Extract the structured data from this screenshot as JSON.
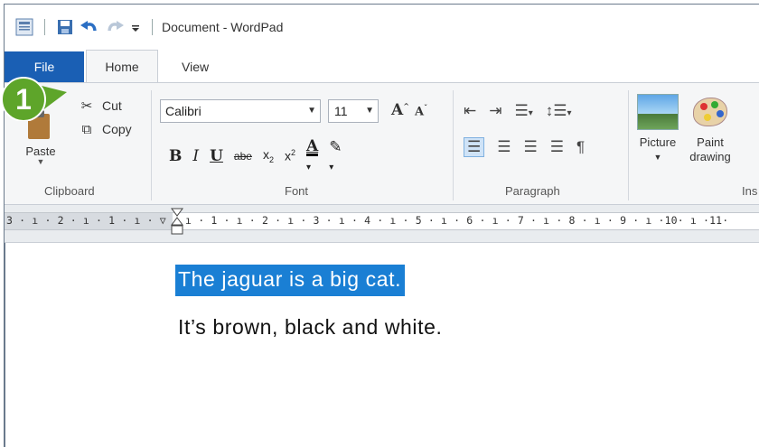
{
  "window": {
    "title": "Document - WordPad"
  },
  "tabs": {
    "file": "File",
    "home": "Home",
    "view": "View"
  },
  "clipboard": {
    "paste": "Paste",
    "cut": "Cut",
    "copy": "Copy",
    "group_label": "Clipboard"
  },
  "font": {
    "name": "Calibri",
    "size": "11",
    "group_label": "Font"
  },
  "paragraph": {
    "group_label": "Paragraph"
  },
  "insert": {
    "picture": "Picture",
    "paint_line1": "Paint",
    "paint_line2": "drawing",
    "group_label": "Ins"
  },
  "ruler": {
    "text": "3 · ı · 2 · ı · 1 · ı · ▽ · ı · 1 · ı · 2 · ı · 3 · ı · 4 · ı · 5 · ı · 6 · ı · 7 · ı · 8 · ı · 9 · ı ·10· ı ·11·"
  },
  "document": {
    "lines": [
      "The jaguar is a big cat.",
      "It’s brown, black and white."
    ]
  },
  "callout": {
    "number": "1",
    "color": "#5ea52a"
  },
  "colors": {
    "file_tab": "#1a5fb4",
    "selection": "#1a7fd4"
  }
}
